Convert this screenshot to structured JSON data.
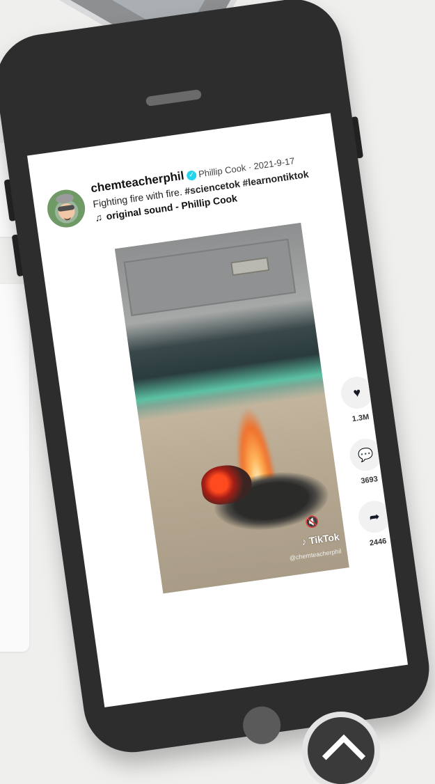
{
  "post": {
    "username": "chemteacherphil",
    "meta": "Phillip Cook · 2021-9-17",
    "caption_text": "Fighting fire with fire.",
    "caption_tags": "#sciencetok #learnontiktok",
    "sound": "original sound - Phillip Cook"
  },
  "video": {
    "watermark": "TikTok",
    "watermark_user": "@chemteacherphil"
  },
  "actions": {
    "likes": "1.3M",
    "comments": "3693",
    "shares": "2446"
  },
  "icons": {
    "verified": "verified-check-icon",
    "music": "music-note-icon",
    "like": "heart-icon",
    "comment": "comment-bubble-icon",
    "share": "share-arrow-icon",
    "mute": "speaker-mute-icon",
    "scroll_top": "chevron-up-icon"
  }
}
